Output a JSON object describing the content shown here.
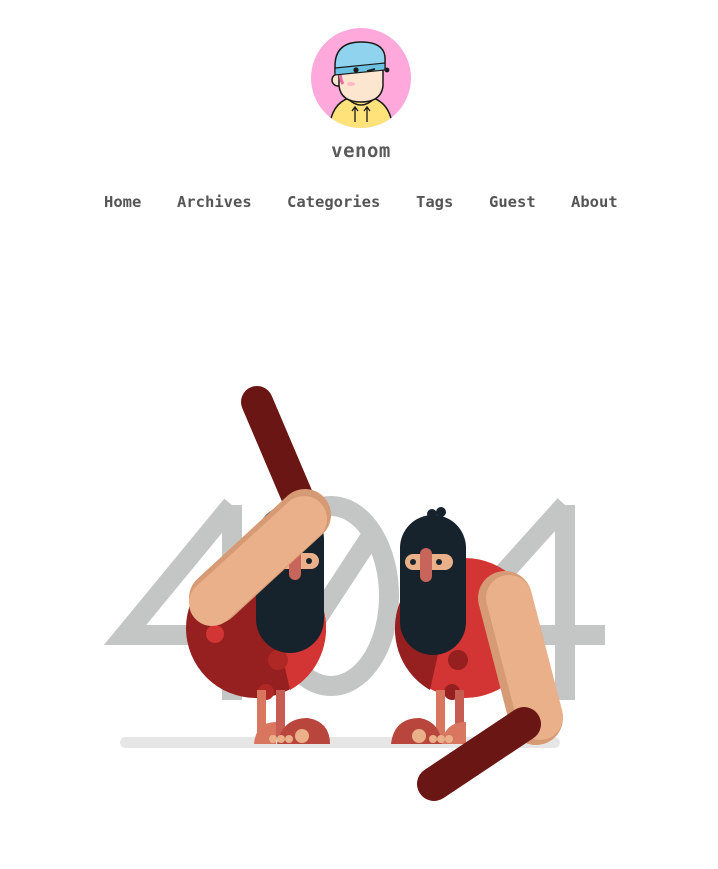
{
  "site": {
    "name": "venom"
  },
  "nav": {
    "items": [
      {
        "label": "Home"
      },
      {
        "label": "Archives"
      },
      {
        "label": "Categories"
      },
      {
        "label": "Tags"
      },
      {
        "label": "Guest"
      },
      {
        "label": "About"
      }
    ]
  },
  "error": {
    "code": "404"
  },
  "colors": {
    "avatar_bg": "#ffa8dc",
    "nav_text": "#555555",
    "digits": "#c4c6c5",
    "body_red": "#d23533",
    "body_dark_red": "#96201f",
    "skin": "#e9b08a",
    "mask": "#16232c",
    "club": "#6a1614"
  }
}
